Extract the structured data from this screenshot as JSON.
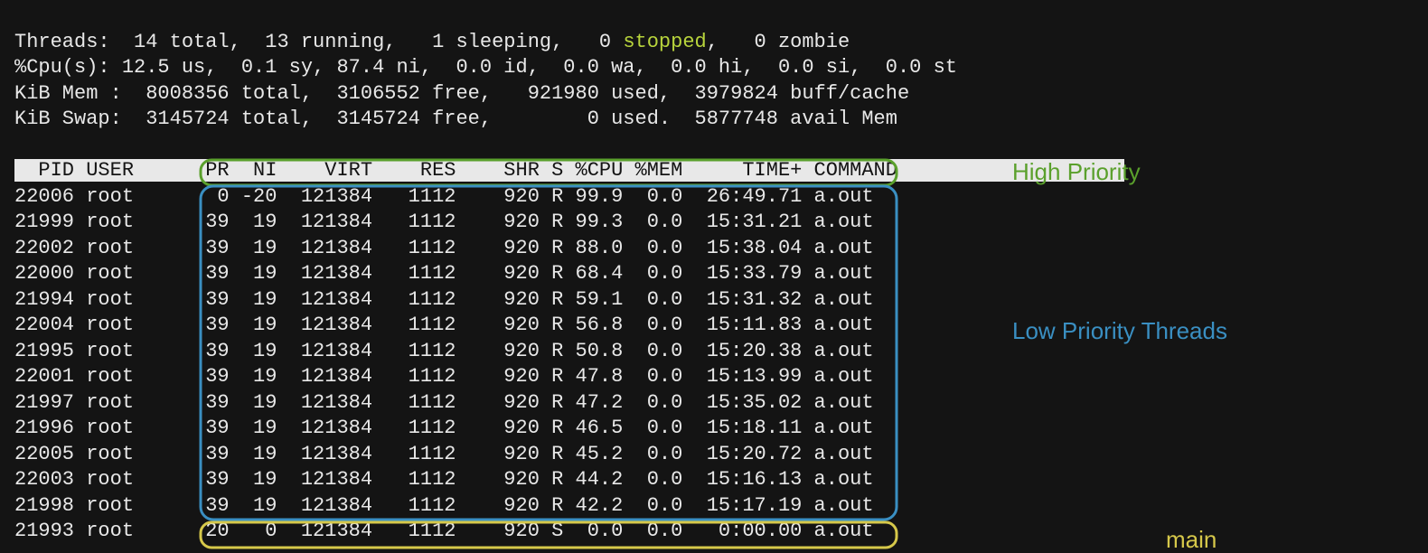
{
  "summary": {
    "threads_line_a": "Threads:  14 total,  13 running,   1 sleeping,   0 ",
    "threads_stopped_word": "stopped",
    "threads_line_b": ",   0 zombie",
    "cpu_line": "%Cpu(s): 12.5 us,  0.1 sy, 87.4 ni,  0.0 id,  0.0 wa,  0.0 hi,  0.0 si,  0.0 st",
    "mem_line": "KiB Mem :  8008356 total,  3106552 free,   921980 used,  3979824 buff/cache",
    "swap_line": "KiB Swap:  3145724 total,  3145724 free,        0 used.  5877748 avail Mem"
  },
  "columns": [
    "PID",
    "USER",
    "PR",
    "NI",
    "VIRT",
    "RES",
    "SHR",
    "S",
    "%CPU",
    "%MEM",
    "TIME+",
    "COMMAND"
  ],
  "header_line": "  PID USER      PR  NI    VIRT    RES    SHR S %CPU %MEM     TIME+ COMMAND                   ",
  "rows": [
    {
      "pid": "22006",
      "user": "root",
      "pr": "0",
      "ni": "-20",
      "virt": "121384",
      "res": "1112",
      "shr": "920",
      "s": "R",
      "cpu": "99.9",
      "mem": "0.0",
      "time": "26:49.71",
      "cmd": "a.out"
    },
    {
      "pid": "21999",
      "user": "root",
      "pr": "39",
      "ni": "19",
      "virt": "121384",
      "res": "1112",
      "shr": "920",
      "s": "R",
      "cpu": "99.3",
      "mem": "0.0",
      "time": "15:31.21",
      "cmd": "a.out"
    },
    {
      "pid": "22002",
      "user": "root",
      "pr": "39",
      "ni": "19",
      "virt": "121384",
      "res": "1112",
      "shr": "920",
      "s": "R",
      "cpu": "88.0",
      "mem": "0.0",
      "time": "15:38.04",
      "cmd": "a.out"
    },
    {
      "pid": "22000",
      "user": "root",
      "pr": "39",
      "ni": "19",
      "virt": "121384",
      "res": "1112",
      "shr": "920",
      "s": "R",
      "cpu": "68.4",
      "mem": "0.0",
      "time": "15:33.79",
      "cmd": "a.out"
    },
    {
      "pid": "21994",
      "user": "root",
      "pr": "39",
      "ni": "19",
      "virt": "121384",
      "res": "1112",
      "shr": "920",
      "s": "R",
      "cpu": "59.1",
      "mem": "0.0",
      "time": "15:31.32",
      "cmd": "a.out"
    },
    {
      "pid": "22004",
      "user": "root",
      "pr": "39",
      "ni": "19",
      "virt": "121384",
      "res": "1112",
      "shr": "920",
      "s": "R",
      "cpu": "56.8",
      "mem": "0.0",
      "time": "15:11.83",
      "cmd": "a.out"
    },
    {
      "pid": "21995",
      "user": "root",
      "pr": "39",
      "ni": "19",
      "virt": "121384",
      "res": "1112",
      "shr": "920",
      "s": "R",
      "cpu": "50.8",
      "mem": "0.0",
      "time": "15:20.38",
      "cmd": "a.out"
    },
    {
      "pid": "22001",
      "user": "root",
      "pr": "39",
      "ni": "19",
      "virt": "121384",
      "res": "1112",
      "shr": "920",
      "s": "R",
      "cpu": "47.8",
      "mem": "0.0",
      "time": "15:13.99",
      "cmd": "a.out"
    },
    {
      "pid": "21997",
      "user": "root",
      "pr": "39",
      "ni": "19",
      "virt": "121384",
      "res": "1112",
      "shr": "920",
      "s": "R",
      "cpu": "47.2",
      "mem": "0.0",
      "time": "15:35.02",
      "cmd": "a.out"
    },
    {
      "pid": "21996",
      "user": "root",
      "pr": "39",
      "ni": "19",
      "virt": "121384",
      "res": "1112",
      "shr": "920",
      "s": "R",
      "cpu": "46.5",
      "mem": "0.0",
      "time": "15:18.11",
      "cmd": "a.out"
    },
    {
      "pid": "22005",
      "user": "root",
      "pr": "39",
      "ni": "19",
      "virt": "121384",
      "res": "1112",
      "shr": "920",
      "s": "R",
      "cpu": "45.2",
      "mem": "0.0",
      "time": "15:20.72",
      "cmd": "a.out"
    },
    {
      "pid": "22003",
      "user": "root",
      "pr": "39",
      "ni": "19",
      "virt": "121384",
      "res": "1112",
      "shr": "920",
      "s": "R",
      "cpu": "44.2",
      "mem": "0.0",
      "time": "15:16.13",
      "cmd": "a.out"
    },
    {
      "pid": "21998",
      "user": "root",
      "pr": "39",
      "ni": "19",
      "virt": "121384",
      "res": "1112",
      "shr": "920",
      "s": "R",
      "cpu": "42.2",
      "mem": "0.0",
      "time": "15:17.19",
      "cmd": "a.out"
    },
    {
      "pid": "21993",
      "user": "root",
      "pr": "20",
      "ni": "0",
      "virt": "121384",
      "res": "1112",
      "shr": "920",
      "s": "S",
      "cpu": "0.0",
      "mem": "0.0",
      "time": "0:00.00",
      "cmd": "a.out"
    }
  ],
  "annotations": {
    "high": "High Priority",
    "low": "Low Priority Threads",
    "main": "main"
  },
  "colors": {
    "bg": "#141414",
    "fg": "#e8e8e8",
    "green": "#5aa02c",
    "olive": "#b8d43c",
    "blue": "#3a8fc2",
    "yellow": "#d6c84a"
  }
}
